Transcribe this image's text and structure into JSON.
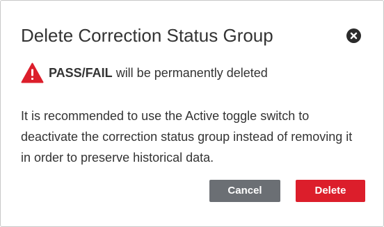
{
  "dialog": {
    "title": "Delete Correction Status Group",
    "close_icon": "close-circle-icon",
    "warning": {
      "icon": "warning-triangle-icon",
      "icon_color": "#dc1e2b",
      "item_name": "PASS/FAIL",
      "message": " will be permanently deleted"
    },
    "body": "It is recommended to use the Active toggle switch to deactivate the correction status group instead of removing it in order to preserve historical data.",
    "buttons": {
      "cancel_label": "Cancel",
      "delete_label": "Delete"
    },
    "colors": {
      "cancel": "#6b6f74",
      "delete": "#dc1e2b",
      "text": "#333333"
    }
  }
}
